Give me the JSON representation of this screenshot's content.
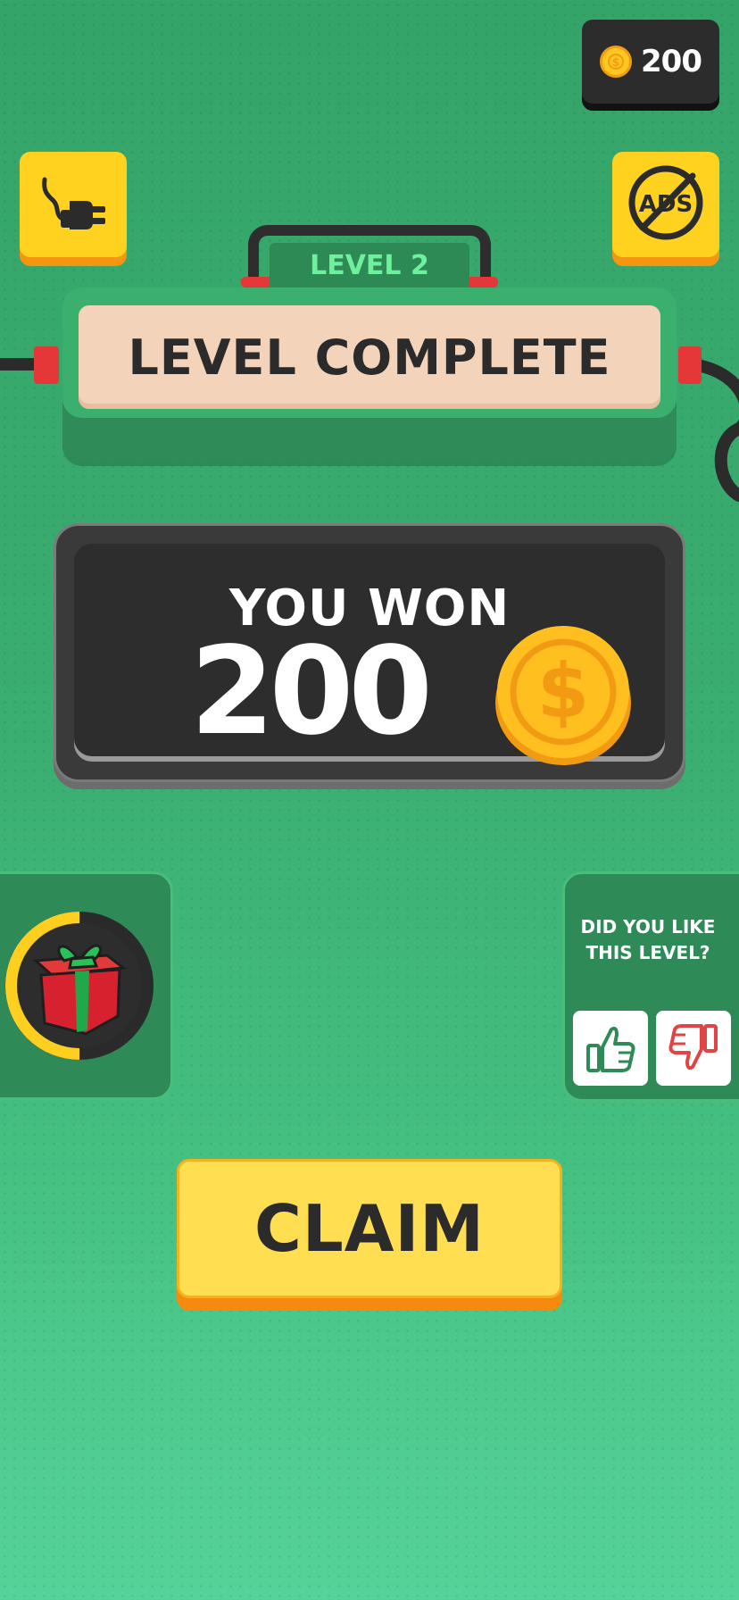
{
  "hud": {
    "coin_balance": "200",
    "coin_icon": "coin-icon",
    "plug_icon": "plug-icon",
    "no_ads_icon": "no-ads-icon",
    "no_ads_text": "ADS"
  },
  "banner": {
    "level_label": "LEVEL 2",
    "title": "LEVEL COMPLETE"
  },
  "reward": {
    "heading": "YOU WON",
    "amount": "200",
    "coin_icon": "coin-icon",
    "coin_symbol": "$"
  },
  "gift": {
    "icon": "gift-icon",
    "progress": 0.5
  },
  "rating": {
    "question": "DID YOU LIKE THIS LEVEL?",
    "like_icon": "thumbs-up-icon",
    "dislike_icon": "thumbs-down-icon"
  },
  "claim": {
    "label": "CLAIM"
  },
  "colors": {
    "background": "#3aad70",
    "accent_yellow": "#ffd21f",
    "accent_orange": "#f39710",
    "dark_panel": "#2d2d2d",
    "level_text": "#6ff09c",
    "like_green": "#2e8a56",
    "dislike_red": "#e04444"
  }
}
